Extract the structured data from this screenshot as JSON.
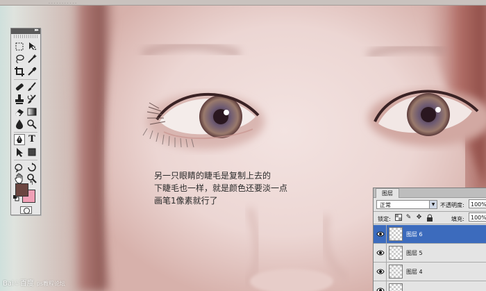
{
  "annotation": {
    "line1": "另一只眼睛的睫毛是复制上去的",
    "line2": "下睫毛也一样，就是颜色还要淡一点",
    "line3": "画笔1像素就行了"
  },
  "toolbox": {
    "collapse_glyph": "▸▸",
    "tools": [
      "rect-marquee",
      "move",
      "lasso",
      "magic-wand",
      "crop",
      "eyedropper",
      "healing-brush",
      "brush",
      "clone-stamp",
      "history-brush",
      "eraser",
      "gradient",
      "blur",
      "dodge",
      "pen",
      "type",
      "path-select",
      "rectangle-shape",
      "notes",
      "eyedropper-3d",
      "hand",
      "zoom"
    ],
    "foreground_color": "#6b4540",
    "background_color": "#f0a0b6"
  },
  "layers_panel": {
    "tab_label": "图层",
    "blend_mode": "正常",
    "opacity_label": "不透明度:",
    "opacity_value": "100%",
    "lock_label": "锁定:",
    "fill_label": "填充:",
    "fill_value": "100%",
    "layers": [
      {
        "name": "图层 6",
        "selected": true
      },
      {
        "name": "图层 5",
        "selected": false
      },
      {
        "name": "图层 4",
        "selected": false
      },
      {
        "name": "",
        "selected": false
      }
    ],
    "selection_color": "#3c6bbd"
  },
  "watermark": {
    "brand": "Bai♧百度",
    "sub": "ps教程论坛"
  }
}
